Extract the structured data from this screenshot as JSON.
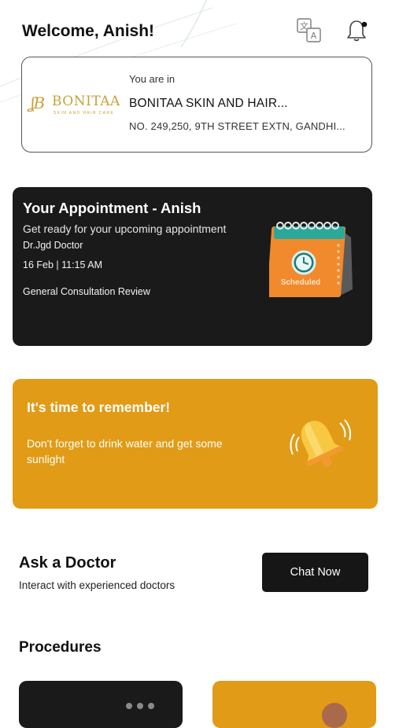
{
  "header": {
    "welcome": "Welcome, Anish!"
  },
  "icons": {
    "translate": "translate-icon",
    "notifications": "bell-icon"
  },
  "clinic": {
    "label": "You are in",
    "logo_text": "BONITAA",
    "logo_subtext": "SKIN AND HAIR CARE",
    "name": "BONITAA SKIN AND HAIR...",
    "address": "NO. 249,250, 9TH STREET EXTN, GANDHI..."
  },
  "appointment": {
    "title": "Your Appointment - Anish",
    "subtitle": "Get ready for your upcoming appointment",
    "doctor": "Dr.Jgd Doctor",
    "datetime": "16 Feb | 11:15 AM",
    "type": "General Consultation Review",
    "status": "Scheduled"
  },
  "reminder": {
    "title": "It's time to remember!",
    "text": "Don't forget to drink water and get some sunlight"
  },
  "ask_doctor": {
    "title": "Ask a Doctor",
    "subtitle": "Interact with experienced doctors",
    "button": "Chat Now"
  },
  "procedures": {
    "title": "Procedures"
  },
  "colors": {
    "accent": "#e19b16",
    "dark_card": "#1a1a1a",
    "logo_gold": "#c9a13a",
    "calendar_orange": "#f08a2c",
    "calendar_teal": "#2aa99a"
  }
}
